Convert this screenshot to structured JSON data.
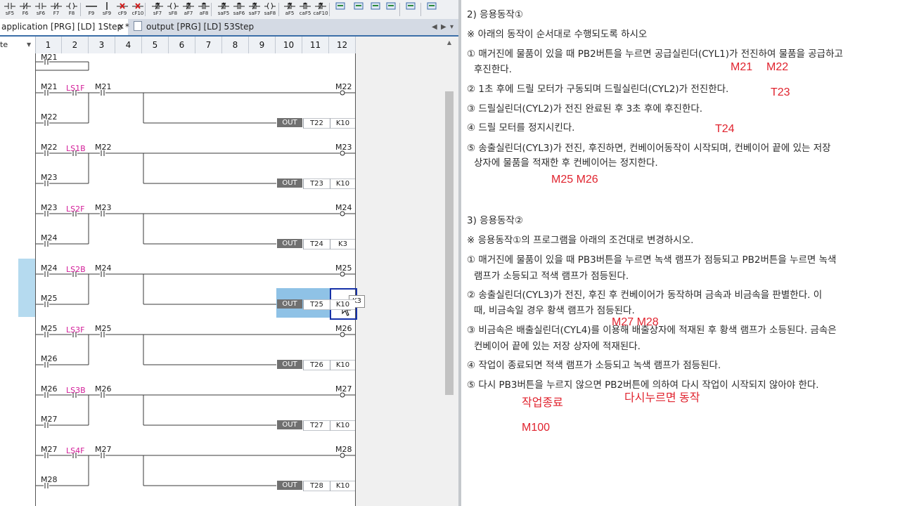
{
  "toolbar": {
    "buttons": [
      {
        "label": "sF5",
        "icon": "contact-icon"
      },
      {
        "label": "F6",
        "icon": "contact-nc-icon"
      },
      {
        "label": "sF6",
        "icon": "contact-parallel-icon"
      },
      {
        "label": "F7",
        "icon": "contact-parallel-nc-icon"
      },
      {
        "label": "F8",
        "icon": "coil-icon"
      },
      {
        "label": "F9",
        "icon": "horizontal-line-icon"
      },
      {
        "label": "sF9",
        "icon": "vertical-line-icon"
      },
      {
        "label": "cF9",
        "icon": "delete-line-icon"
      },
      {
        "label": "cF10",
        "icon": "delete-vertical-icon"
      },
      {
        "label": "sF7",
        "icon": "rising-contact-icon"
      },
      {
        "label": "sF8",
        "icon": "falling-contact-icon"
      },
      {
        "label": "aF7",
        "icon": "rising-parallel-icon"
      },
      {
        "label": "aF8",
        "icon": "falling-parallel-icon"
      },
      {
        "label": "saF5",
        "icon": "pulse-rise-icon"
      },
      {
        "label": "saF6",
        "icon": "pulse-fall-icon"
      },
      {
        "label": "saF7",
        "icon": "pulse-rise-parallel-icon"
      },
      {
        "label": "saF8",
        "icon": "pulse-fall-parallel-icon"
      },
      {
        "label": "aF5",
        "icon": "invert-icon"
      },
      {
        "label": "caF5",
        "icon": "operation-rise-icon"
      },
      {
        "label": "caF10",
        "icon": "operation-fall-icon"
      },
      {
        "label": "",
        "icon": "function-block-icon"
      },
      {
        "label": "",
        "icon": "inline-st-icon"
      },
      {
        "label": "",
        "icon": "monitor-icon"
      },
      {
        "label": "",
        "icon": "write-icon"
      },
      {
        "label": "",
        "icon": "read-icon"
      },
      {
        "label": "",
        "icon": "comment-icon"
      }
    ]
  },
  "tabs": [
    {
      "label": "application [PRG] [LD] 1Step *",
      "active": true
    },
    {
      "label": "output [PRG] [LD] 53Step",
      "active": false
    }
  ],
  "column_header": {
    "left_label": "te",
    "columns": [
      "1",
      "2",
      "3",
      "4",
      "5",
      "6",
      "7",
      "8",
      "9",
      "10",
      "11",
      "12"
    ]
  },
  "ladder": {
    "top_partial": {
      "contact": "M21"
    },
    "rungs": [
      {
        "c1": "M21",
        "c2": "LS1F",
        "c3": "M21",
        "coil": "M22",
        "c4": "M22",
        "timer": "T22",
        "k": "K10"
      },
      {
        "c1": "M22",
        "c2": "LS1B",
        "c3": "M22",
        "coil": "M23",
        "c4": "M23",
        "timer": "T23",
        "k": "K10"
      },
      {
        "c1": "M23",
        "c2": "LS2F",
        "c3": "M23",
        "coil": "M24",
        "c4": "M24",
        "timer": "T24",
        "k": "K3"
      },
      {
        "c1": "M24",
        "c2": "LS2B",
        "c3": "M24",
        "coil": "M25",
        "c4": "M25",
        "timer": "T25",
        "k": "K10"
      },
      {
        "c1": "M25",
        "c2": "LS3F",
        "c3": "M25",
        "coil": "M26",
        "c4": "M26",
        "timer": "T26",
        "k": "K10"
      },
      {
        "c1": "M26",
        "c2": "LS3B",
        "c3": "M26",
        "coil": "M27",
        "c4": "M27",
        "timer": "T27",
        "k": "K10"
      },
      {
        "c1": "M27",
        "c2": "LS4F",
        "c3": "M27",
        "coil": "M28",
        "c4": "M28",
        "timer": "T28",
        "k": "K10"
      }
    ],
    "out_label": "OUT",
    "tooltip": "K3"
  },
  "document": {
    "lines": [
      "2) 응용동작①",
      "※ 아래의 동작이 순서대로 수행되도록 하시오",
      "① 매거진에 물품이 있을 때 PB2버튼을 누르면 공급실린더(CYL1)가 전진하여 물품을 공급하고",
      "후진한다.",
      "② 1초 후에 드릴 모터가 구동되며 드릴실린더(CYL2)가 전진한다.",
      "③ 드릴실린더(CYL2)가 전진 완료된 후 3초 후에 후진한다.",
      "④ 드릴 모터를 정지시킨다.",
      "⑤ 송출실린더(CYL3)가 전진, 후진하면, 컨베이어동작이 시작되며, 컨베이어 끝에 있는 저장",
      "상자에 물품을 적재한 후 컨베이어는 정지한다.",
      "3) 응용동작②",
      "※ 응용동작①의 프로그램을 아래의 조건대로 변경하시오.",
      "① 매거진에 물품이 있을 때 PB3버튼을 누르면 녹색 램프가 점등되고 PB2버튼을 누르면 녹색",
      "램프가 소등되고 적색 램프가 점등된다.",
      "② 송출실린더(CYL3)가 전진, 후진 후 컨베이어가 동작하며 금속과 비금속을 판별한다. 이",
      "때, 비금속일 경우 황색 램프가 점등된다.",
      "③ 비금속은 배출실린더(CYL4)를 이용해 배출상자에 적재된 후 황색 램프가 소등된다. 금속은",
      "컨베이어 끝에 있는 저장 상자에 적재된다.",
      "④ 작업이 종료되면 적색 램프가 소등되고 녹색 램프가 점등된다.",
      "⑤ 다시 PB3버튼을 누르지 않으면 PB2버튼에 의하여 다시 작업이 시작되지 않아야 한다."
    ],
    "handwritten_notes": [
      "M21",
      "M22",
      "T23",
      "T24",
      "M25 M26",
      "M27 M28",
      "작업종료",
      "다시누르면 동작",
      "M100"
    ]
  },
  "colors": {
    "handwriting": "#e0232e",
    "limit_switch_label": "#d21c98",
    "selection": "#6aaedd",
    "cursor": "#1631a8"
  }
}
